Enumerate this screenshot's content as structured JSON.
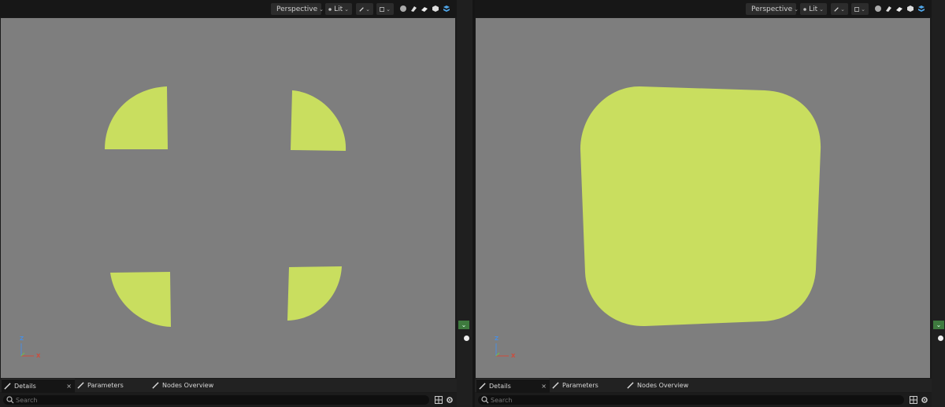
{
  "panels": [
    {
      "id": "left",
      "toolbar": {
        "view_mode": "Perspective",
        "lighting": "Lit"
      },
      "viewport": {
        "shape_color": "#c9de5f",
        "background_color": "#7e7e7e",
        "axis": {
          "z": "Z",
          "x": "X"
        }
      },
      "tabs": [
        {
          "label": "Details",
          "active": true,
          "close": "×"
        },
        {
          "label": "Parameters",
          "active": false
        },
        {
          "label": "Nodes Overview",
          "active": false
        }
      ],
      "search": {
        "placeholder": "Search"
      }
    },
    {
      "id": "right",
      "toolbar": {
        "view_mode": "Perspective",
        "lighting": "Lit"
      },
      "viewport": {
        "shape_color": "#c9de5f",
        "background_color": "#7e7e7e",
        "axis": {
          "z": "Z",
          "x": "X"
        }
      },
      "tabs": [
        {
          "label": "Details",
          "active": true,
          "close": "×"
        },
        {
          "label": "Parameters",
          "active": false
        },
        {
          "label": "Nodes Overview",
          "active": false
        }
      ],
      "search": {
        "placeholder": "Search"
      }
    }
  ],
  "colors": {
    "accent": "#2a7fd6",
    "axis_z": "#4a8fe0",
    "axis_x": "#d04a3a",
    "axis_y": "#6fbf4a",
    "green_button": "#3e7a3e"
  },
  "side": {
    "collapse_glyph": "⌄"
  },
  "icons": [
    "camera-icon",
    "lit-sphere-icon",
    "show-flags-icon",
    "screen-percentage-icon",
    "realtime-sphere-icon",
    "eraser-icon",
    "cube-icon",
    "layers-icon",
    "grid-view-icon",
    "settings-gear-icon",
    "search-icon",
    "brush-icon"
  ]
}
